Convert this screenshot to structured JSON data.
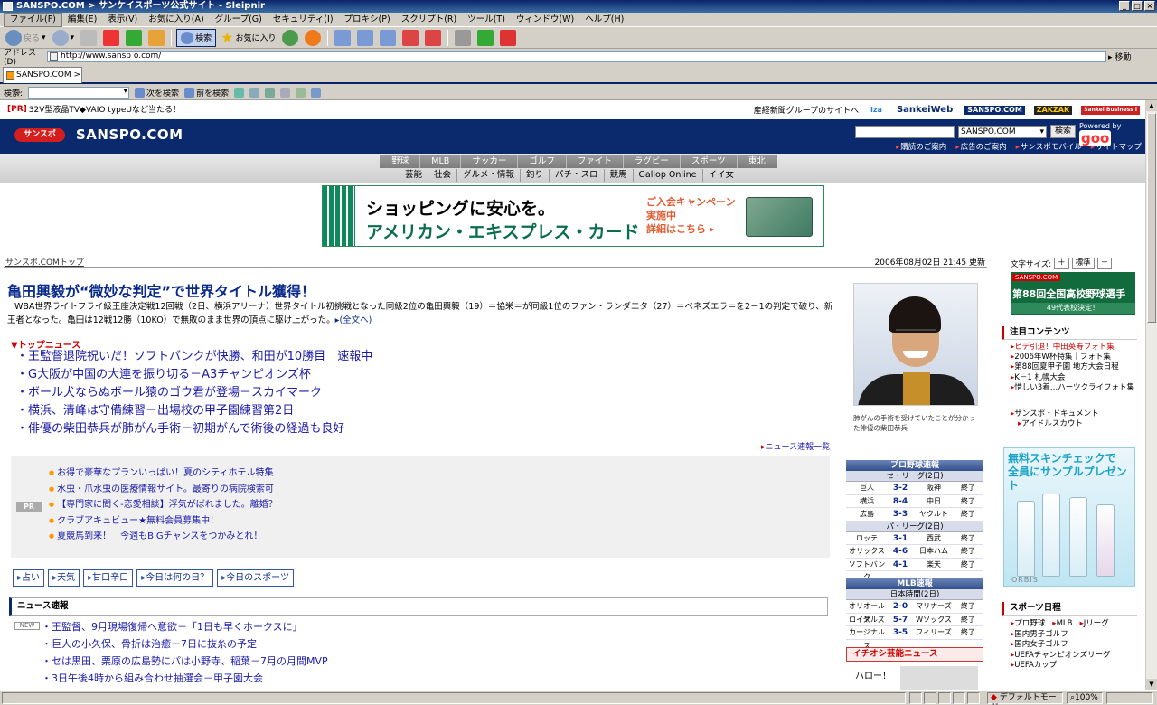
{
  "window": {
    "title": "SANSPO.COM > サンケイスポーツ公式サイト - Sleipnir"
  },
  "menu": [
    "ファイル(F)",
    "編集(E)",
    "表示(V)",
    "お気に入り(A)",
    "グループ(G)",
    "セキュリティ(I)",
    "プロキシ(P)",
    "スクリプト(R)",
    "ツール(T)",
    "ウィンドウ(W)",
    "ヘルプ(H)"
  ],
  "toolbar": {
    "back": "戻る",
    "search": "検索",
    "favorites": "お気に入り"
  },
  "address": {
    "label": "アドレス(D)",
    "url": "http://www.sansp o.com/",
    "go": "移動"
  },
  "tabs": [
    {
      "label": "SANSPO.COM > _"
    }
  ],
  "findbar": {
    "label": "検索:",
    "next": "次を検索",
    "prev": "前を検索"
  },
  "pr_strip": {
    "tag": "[PR]",
    "text": "32V型液晶TV◆VAIO typeUなど当たる！",
    "group_link": "産経新聞グループのサイトへ",
    "logos": [
      "iza",
      "SankeiWeb",
      "SANSPO.COM",
      "ZAKZAK",
      "Sankei Business i"
    ]
  },
  "header": {
    "badge": "サンスポ",
    "brand": "SANSPO.COM",
    "site_select": "SANSPO.COM",
    "search_button": "検索",
    "powered": "Powered by",
    "goo": "goo",
    "links": [
      "購読のご案内",
      "広告のご案内",
      "サンスポモバイル",
      "サイトマップ"
    ]
  },
  "nav": {
    "row1": [
      "野球",
      "MLB",
      "サッカー",
      "ゴルフ",
      "ファイト",
      "ラグビー",
      "スポーツ",
      "東北"
    ],
    "row2": [
      "芸能",
      "社会",
      "グルメ・情報",
      "釣り",
      "パチ・スロ",
      "競馬",
      "Gallop Online",
      "イイ女"
    ]
  },
  "banner": {
    "line1": "ショッピングに安心を。",
    "line2": "アメリカン・エキスプレス・カード",
    "campaign1": "ご入会キャンペーン",
    "campaign2": "実施中",
    "details": "詳細はこちら ▸"
  },
  "breadcrumb": "サンスポ.COMトップ",
  "timestamp": "2006年08月02日 21:45 更新",
  "article": {
    "headline": "亀田興毅が“微妙な判定”で世界タイトル獲得！",
    "lead": "WBA世界ライトフライ級王座決定戦12回戦（2日、横浜アリーナ）世界タイトル初挑戦となった同級2位の亀田興毅（19）＝協栄＝が同級1位のファン・ランダエタ（27）＝ベネズエラ＝を2－1の判定で破り、新王者となった。亀田は12戦12勝（10KO）で無敗のまま世界の頂点に駆け上がった。",
    "more": "▸(全文へ)"
  },
  "top_news": {
    "heading": "▼トップニュース",
    "items": [
      "王監督退院祝いだ！ソフトバンクが快勝、和田が10勝目　速報中",
      "G大阪が中国の大連を振り切る－A3チャンピオンズ杯",
      "ボール犬ならぬボール猿のゴウ君が登場－スカイマーク",
      "横浜、清峰は守備練習－出場校の甲子園練習第2日",
      "俳優の柴田恭兵が肺がん手術－初期がんで術後の経過も良好"
    ],
    "list_link": "ニュース速報一覧"
  },
  "pr_box": {
    "badge": "PR",
    "items": [
      "お得で豪華なプランいっぱい！夏のシティホテル特集",
      "水虫・爪水虫の医療情報サイト。最寄りの病院検索可",
      "【専門家に聞く-恋愛相談】浮気がばれました。離婚？",
      "クラブアキュビュー★無料会員募集中！",
      "夏競馬到来！　今週もBIGチャンスをつかみとれ！"
    ]
  },
  "quick_links": [
    "占い",
    "天気",
    "甘口辛口",
    "今日は何の日？",
    "今日のスポーツ"
  ],
  "flash": {
    "heading": "ニュース速報",
    "new_tag": "NEW",
    "items": [
      "王監督、9月現場復帰へ意欲－「1日も早くホークスに」",
      "巨人の小久保、骨折は治癒－7日に抜糸の予定",
      "セは黒田、栗原の広島勢にパは小野寺、稲葉－7月の月間MVP",
      "3日午後4時から組み合わせ抽選会－甲子園大会"
    ]
  },
  "photo_caption": "肺がんの手術を受けていたことが分かった俳優の柴田恭兵",
  "pro_baseball": {
    "heading": "プロ野球速報",
    "central_label": "セ・リーグ(2日)",
    "central": [
      {
        "home": "巨人",
        "score": "3-2",
        "away": "阪神",
        "status": "終了"
      },
      {
        "home": "横浜",
        "score": "8-4",
        "away": "中日",
        "status": "終了"
      },
      {
        "home": "広島",
        "score": "3-3",
        "away": "ヤクルト",
        "status": "終了"
      }
    ],
    "pacific_label": "パ・リーグ(2日)",
    "pacific": [
      {
        "home": "ロッテ",
        "score": "3-1",
        "away": "西武",
        "status": "終了"
      },
      {
        "home": "オリックス",
        "score": "4-6",
        "away": "日本ハム",
        "status": "終了"
      },
      {
        "home": "ソフトバンク",
        "score": "4-1",
        "away": "楽天",
        "status": "終了"
      }
    ]
  },
  "mlb": {
    "heading": "MLB速報",
    "sub": "日本時間(2日)",
    "games": [
      {
        "home": "オリオールズ",
        "score": "2-0",
        "away": "マリナーズ",
        "status": "終了"
      },
      {
        "home": "ロイヤルズ",
        "score": "5-7",
        "away": "Wソックス",
        "status": "終了"
      },
      {
        "home": "カージナルス",
        "score": "3-5",
        "away": "フィリーズ",
        "status": "終了"
      }
    ]
  },
  "geinou": {
    "heading": "イチオシ芸能ニュース",
    "teaser": "ハロー！"
  },
  "sidebar": {
    "font_label": "文字サイズ:",
    "font_plus": "＋",
    "font_std": "標準",
    "font_minus": "－",
    "koshien_logo": "SANSPO.COM",
    "koshien_title": "第88回全国高校野球選手権大会",
    "koshien_sub": "49代表校決定！",
    "featured_heading": "注目コンテンツ",
    "featured": [
      "ヒデ引退！中田英寿フォト集",
      "2006年W杯特集｜フォト集",
      "第88回夏甲子園 地方大会日程",
      "K－1 札幌大会",
      "惜しい3着…ハーツクライフォト集"
    ],
    "misc": [
      "サンスポ・ドキュメント",
      "アイドルスカウト"
    ],
    "skin_ad_line1": "無料スキンチェックで",
    "skin_ad_line2": "全員にサンプルプレゼント",
    "skin_ad_brand": "ORBIS",
    "schedule_heading": "スポーツ日程",
    "schedule": [
      "プロ野球",
      "MLB",
      "Jリーグ",
      "国内男子ゴルフ",
      "国内女子ゴルフ",
      "UEFAチャンピオンズリーグ",
      "UEFAカップ"
    ]
  },
  "status": {
    "mode": "デフォルトモード",
    "zoom": "100%"
  }
}
